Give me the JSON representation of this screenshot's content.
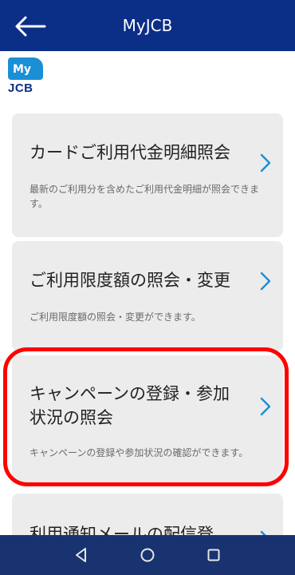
{
  "header": {
    "title": "MyJCB"
  },
  "brand": {
    "logo_top": "My",
    "logo_bottom": "JCB"
  },
  "cards": [
    {
      "title": "カードご利用代金明細照会",
      "desc": "最新のご利用分を含めたご利用代金明細が照会できます。"
    },
    {
      "title": "ご利用限度額の照会・変更",
      "desc": "ご利用限度額の照会・変更ができます。"
    },
    {
      "title": "キャンペーンの登録・参加状況の照会",
      "desc": "キャンペーンの登録や参加状況の確認ができます。"
    },
    {
      "title": "利用通知メールの配信登録・"
    }
  ],
  "colors": {
    "header": "#0b2f86",
    "accent": "#1a8fd6",
    "highlight": "#ff0000",
    "navbar": "#18336f"
  },
  "navbar": {
    "icons": [
      "back-triangle-icon",
      "home-circle-icon",
      "recents-square-icon"
    ]
  }
}
